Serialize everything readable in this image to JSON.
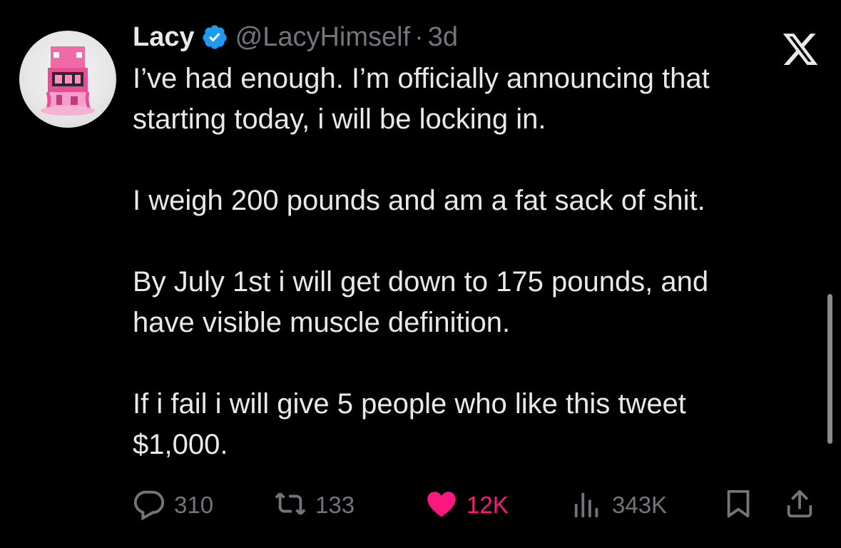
{
  "author": {
    "display_name": "Lacy",
    "handle": "@LacyHimself",
    "separator": "·",
    "time": "3d",
    "verified_icon": "verified-badge-icon",
    "avatar": "avatar-image"
  },
  "platform_logo": "x-logo-icon",
  "tweet": {
    "paragraphs": [
      [
        "I’ve had enough. I’m officially announcing that",
        "starting today, i will be locking in."
      ],
      [
        "I weigh 200 pounds and am a fat sack of shit."
      ],
      [
        "By July 1st i will get down to 175 pounds, and",
        "have visible muscle definition."
      ],
      [
        "If i fail i will give 5 people who like this tweet",
        "$1,000."
      ]
    ]
  },
  "actions": {
    "reply": {
      "icon": "reply-icon",
      "count": "310"
    },
    "retweet": {
      "icon": "retweet-icon",
      "count": "133"
    },
    "like": {
      "icon": "heart-icon",
      "count": "12K",
      "liked": true
    },
    "views": {
      "icon": "views-icon",
      "count": "343K"
    },
    "bookmark": {
      "icon": "bookmark-icon"
    },
    "share": {
      "icon": "share-icon"
    }
  },
  "colors": {
    "background": "#000000",
    "text": "#e7e9ea",
    "muted": "#71767b",
    "verified": "#1d9bf0",
    "like": "#f91880"
  }
}
